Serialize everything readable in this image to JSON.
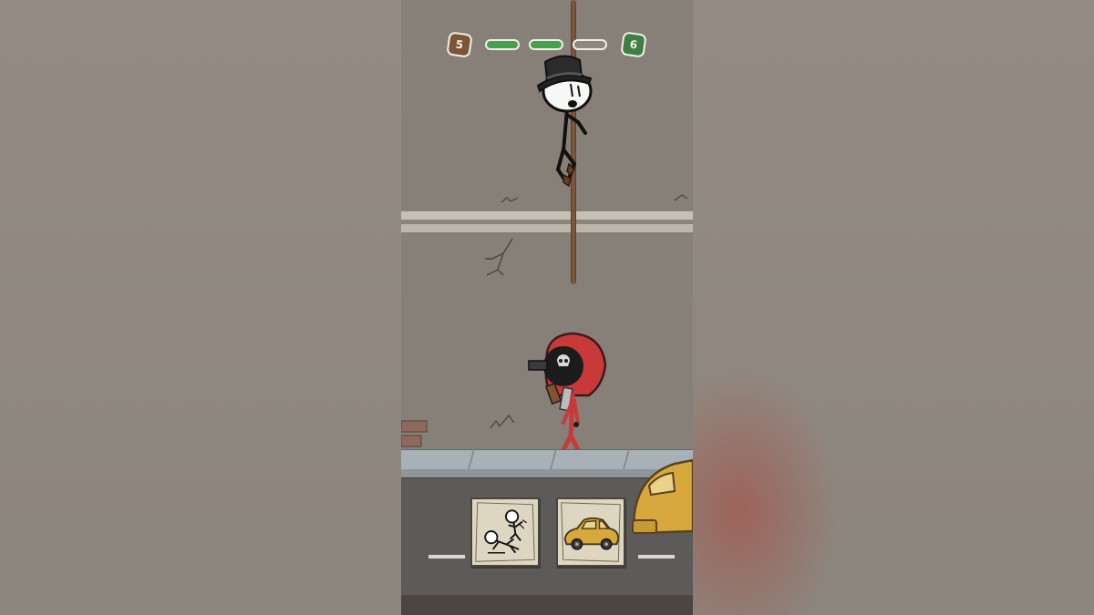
{
  "hud": {
    "current_level": "5",
    "next_level": "6",
    "stages": [
      {
        "status": "done"
      },
      {
        "status": "done"
      },
      {
        "status": "pending"
      }
    ]
  },
  "scene": {
    "player": "henry-stickmin-hanging-on-rope",
    "enemy": "red-hooded-guard-with-gun"
  },
  "choices": [
    {
      "id": "fall-on-guard",
      "icon": "stickman-falling-icon"
    },
    {
      "id": "car",
      "icon": "yellow-car-icon"
    }
  ],
  "colors": {
    "completed_stage": "#47a04f",
    "pending_stage": "#8f8880",
    "current_level_badge": "#7b5634",
    "next_level_badge": "#3f7e45",
    "enemy_red": "#c8393a",
    "car_yellow": "#d7a83b"
  }
}
